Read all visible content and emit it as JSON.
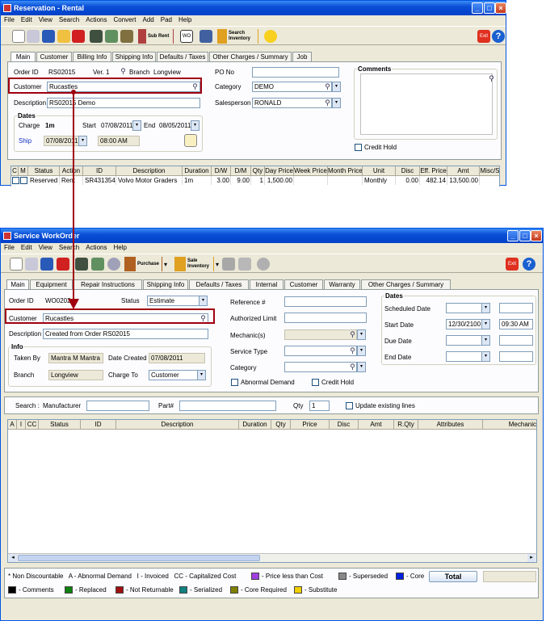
{
  "top": {
    "title": "Reservation - Rental",
    "menu": [
      "File",
      "Edit",
      "View",
      "Search",
      "Actions",
      "Convert",
      "Add",
      "Pad",
      "Help"
    ],
    "toolbar": {
      "subrent": "Sub Rent",
      "search_inventory": "Search\nInventory",
      "exit": "Exit"
    },
    "tabs": [
      "Main",
      "Customer",
      "Billing Info",
      "Shipping Info",
      "Defaults / Taxes",
      "Other Charges / Summary",
      "Job"
    ],
    "order_id_label": "Order ID",
    "order_id": "RS02015",
    "ver_label": "Ver.",
    "ver": "1",
    "branch_label": "Branch",
    "branch": "Longview",
    "customer_label": "Customer",
    "customer": "Rucastles",
    "description_label": "Description",
    "description": "RS02015 Demo",
    "dates_title": "Dates",
    "charge_label": "Charge",
    "charge": "1m",
    "start_label": "Start",
    "start": "07/08/2011",
    "end_label": "End",
    "end": "08/05/2011",
    "ship_label": "Ship",
    "ship_date": "07/08/2011",
    "ship_time": "08:00 AM",
    "po_label": "PO No",
    "po": "",
    "category_label": "Category",
    "category": "DEMO",
    "salesperson_label": "Salesperson",
    "salesperson": "RONALD",
    "comments_title": "Comments",
    "credit_hold": "Credit Hold",
    "grid_headers": [
      "C",
      "M",
      "Status",
      "Action",
      "ID",
      "Description",
      "Duration",
      "D/W",
      "D/M",
      "Qty",
      "Day Price",
      "Week Price",
      "Month Price",
      "Unit",
      "Disc",
      "Eff. Price",
      "Amt",
      "Misc/S"
    ],
    "grid_row": [
      "",
      "",
      "Reserved",
      "Rent",
      "SR431354",
      "Volvo Motor Graders",
      "1m",
      "3.00",
      "9.00",
      "1",
      "1,500.00",
      "",
      "",
      "Monthly",
      "0.00",
      "482.14",
      "13,500.00",
      ""
    ]
  },
  "bottom": {
    "title": "Service WorkOrder",
    "menu": [
      "File",
      "Edit",
      "View",
      "Search",
      "Actions",
      "Help"
    ],
    "toolbar": {
      "purchase": "Purchase",
      "sale_inventory": "Sale\nInventory",
      "exit": "Exit"
    },
    "tabs": [
      "Main",
      "Equipment",
      "Repair Instructions",
      "Shipping Info",
      "Defaults / Taxes",
      "Internal",
      "Customer",
      "Warranty",
      "Other Charges / Summary"
    ],
    "order_id_label": "Order ID",
    "order_id": "WO0202",
    "status_label": "Status",
    "status": "Estimate",
    "customer_label": "Customer",
    "customer": "Rucastles",
    "description_label": "Description",
    "description": "Created from Order RS02015",
    "info_title": "Info",
    "taken_by_label": "Taken By",
    "taken_by": "Mantra M Mantra",
    "date_created_label": "Date Created",
    "date_created": "07/08/2011",
    "branch_label": "Branch",
    "branch": "Longview",
    "charge_to_label": "Charge To",
    "charge_to": "Customer",
    "reference_label": "Reference #",
    "authorized_label": "Authorized Limit",
    "mechanic_label": "Mechanic(s)",
    "service_type_label": "Service Type",
    "category_label": "Category",
    "abnormal_demand": "Abnormal Demand",
    "credit_hold": "Credit Hold",
    "dates_title": "Dates",
    "scheduled_label": "Scheduled Date",
    "start_label": "Start Date",
    "start_date": "12/30/2100",
    "start_time": "09:30 AM",
    "due_label": "Due Date",
    "end_label": "End Date",
    "search_label": "Search :",
    "manufacturer_label": "Manufacturer",
    "part_label": "Part#",
    "qty_label": "Qty",
    "qty": "1",
    "update_existing": "Update existing lines",
    "grid_headers": [
      "A",
      "I",
      "CC",
      "Status",
      "ID",
      "Description",
      "Duration",
      "Qty",
      "Price",
      "Disc",
      "Amt",
      "R.Qty",
      "Attributes",
      "Mechanic"
    ],
    "legend_line1": "* Non Discountable   A - Abnormal Demand   I - Invoiced   CC - Capitalized Cost",
    "legend": [
      {
        "label": "- Price less than Cost",
        "color": "#a040e0"
      },
      {
        "label": "- Superseded",
        "color": "#888888"
      },
      {
        "label": "- Core",
        "color": "#0020e0"
      },
      {
        "label": "- Comments",
        "color": "#000000"
      },
      {
        "label": "- Replaced",
        "color": "#108010"
      },
      {
        "label": "- Not Returnable",
        "color": "#a01010"
      },
      {
        "label": "- Serialized",
        "color": "#108080"
      },
      {
        "label": "- Core Required",
        "color": "#808000"
      },
      {
        "label": "- Substitute",
        "color": "#f0d000"
      }
    ],
    "total_label": "Total",
    "total": ""
  }
}
